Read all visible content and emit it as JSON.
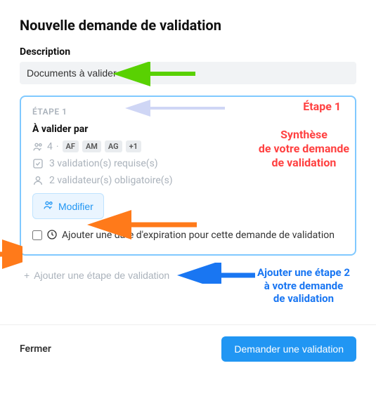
{
  "header": {
    "title": "Nouvelle demande de validation"
  },
  "description": {
    "label": "Description",
    "value": "Documents à valider"
  },
  "step1": {
    "header": "ÉTAPE 1",
    "validate_label": "À valider par",
    "count": "4",
    "badges": [
      "AF",
      "AM",
      "AG",
      "+1"
    ],
    "required": "3 validation(s) requise(s)",
    "mandatory": "2 validateur(s) obligatoire(s)",
    "modify": "Modifier",
    "expire": "Ajouter une date d'expiration pour cette demande de validation"
  },
  "add_step": "Ajouter une étape de validation",
  "footer": {
    "close": "Fermer",
    "submit": "Demander une validation"
  },
  "annotations": {
    "etape1": "Étape 1",
    "synthese": "Synthèse\nde votre demande\nde validation",
    "add2": "Ajouter une étape 2\nà votre demande\nde validation"
  }
}
